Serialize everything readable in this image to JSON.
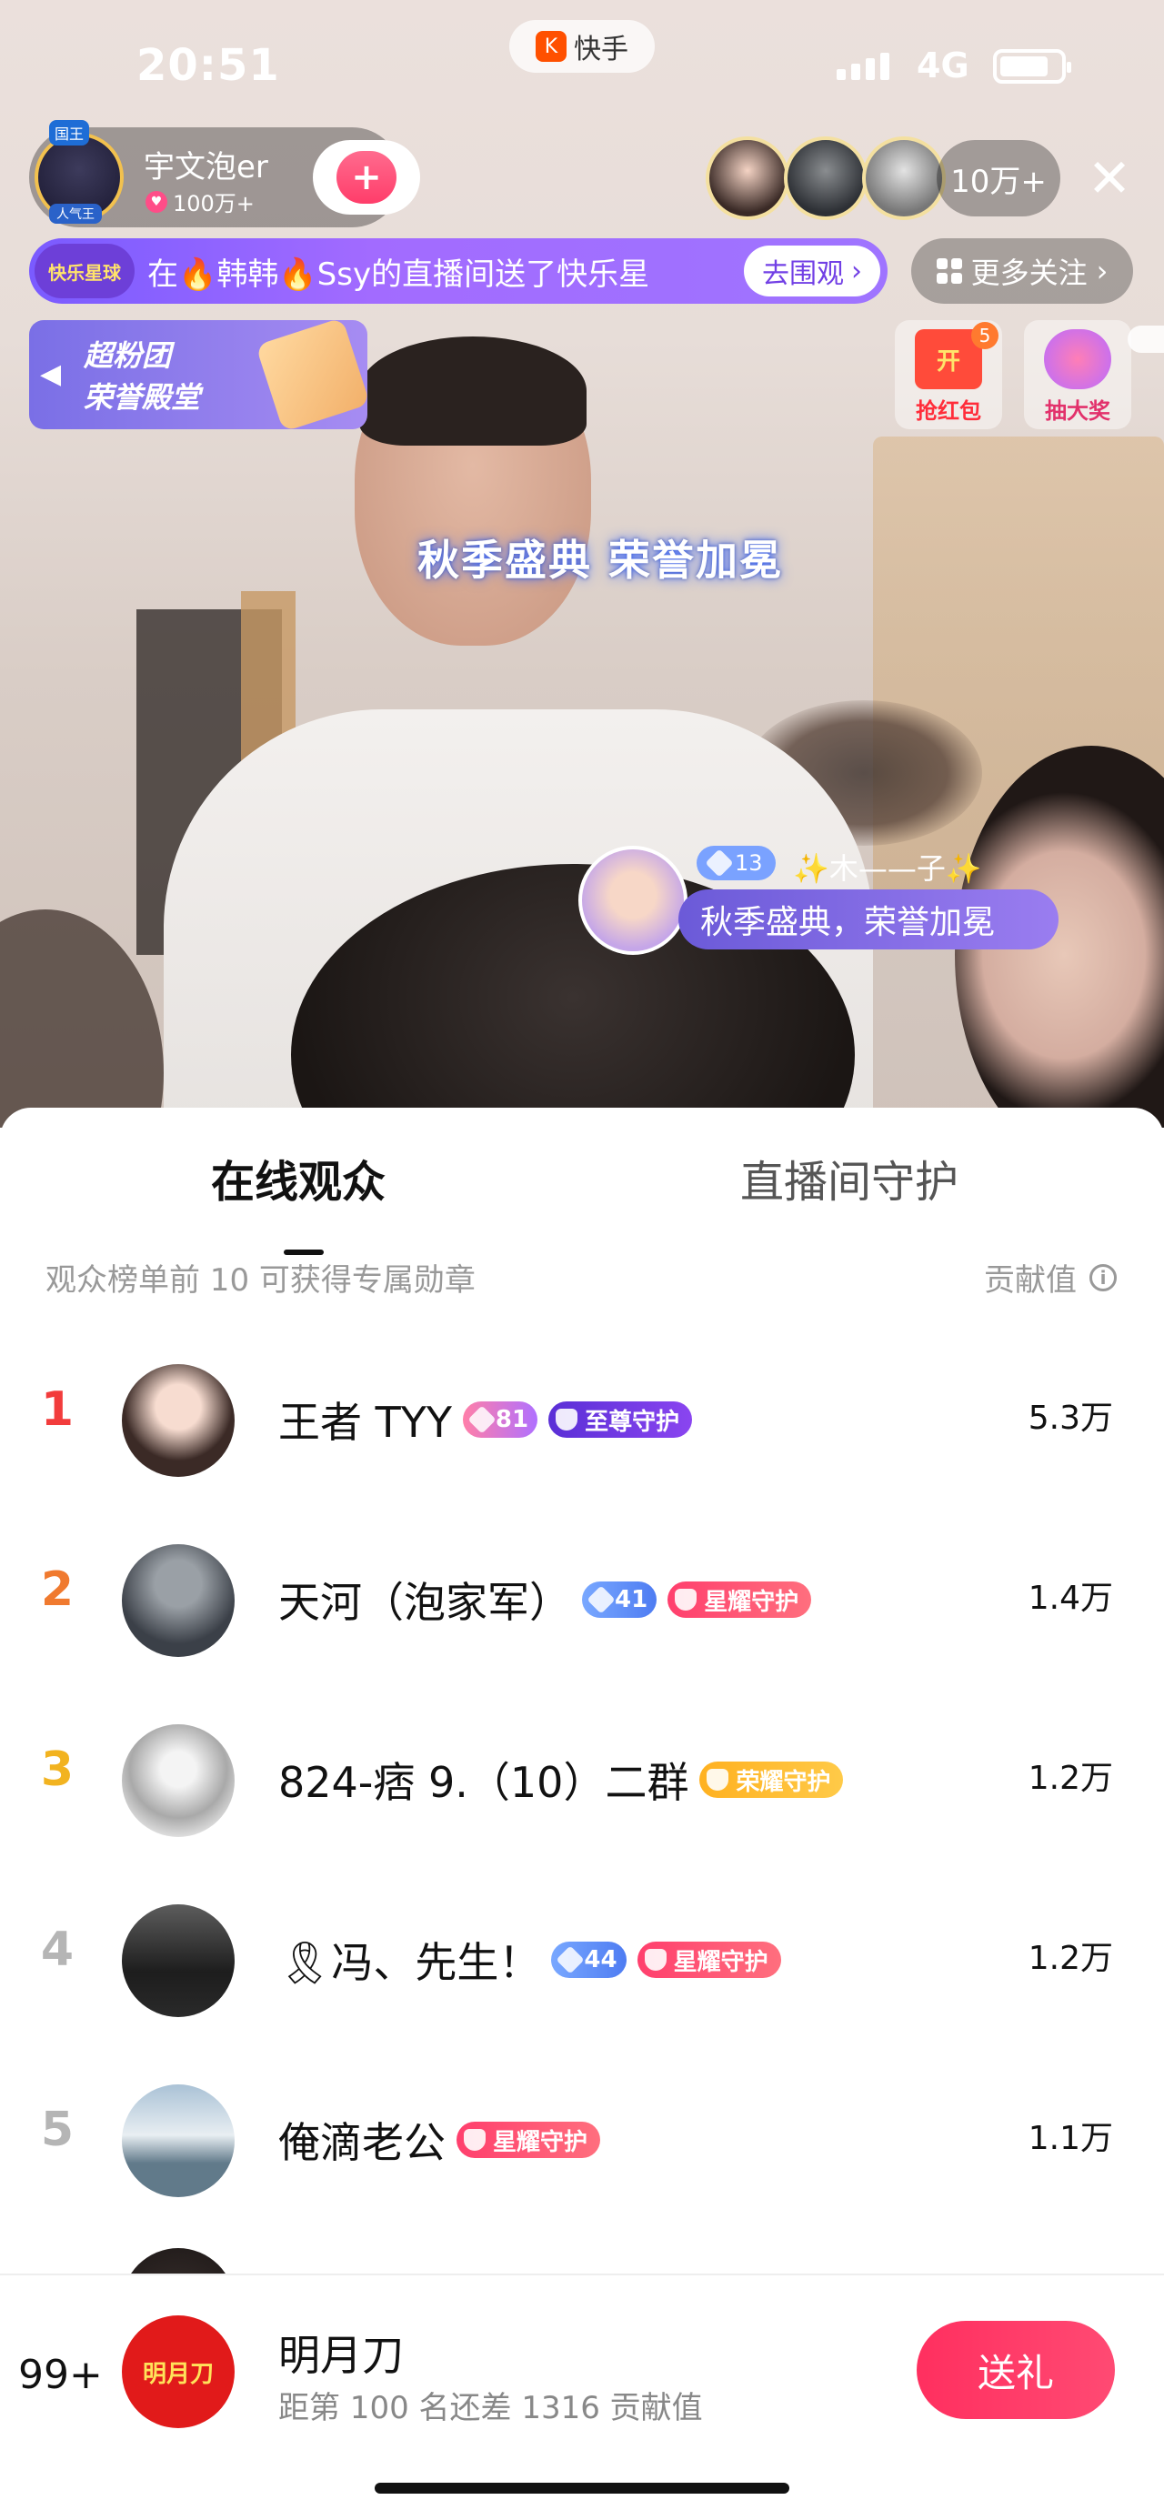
{
  "status": {
    "time": "20:51",
    "network": "4G"
  },
  "app": {
    "name": "快手",
    "logo_glyph": "K"
  },
  "host": {
    "name": "宇文泡er",
    "fans": "100万+",
    "crown": "国王",
    "tag": "人气王",
    "follow_icon": "+"
  },
  "viewers": {
    "count": "10万+"
  },
  "banner": {
    "badge": "快乐星球",
    "text": "在🔥韩韩🔥Ssy的直播间送了快乐星",
    "go_label": "去围观",
    "go_arrow": "›"
  },
  "more_follow": {
    "label": "更多关注",
    "arrow": "›"
  },
  "fan_card": {
    "line1": "超粉团",
    "line2": "荣誉殿堂",
    "arrow": "◀"
  },
  "red_packet": {
    "label": "抢红包",
    "box_text": "开",
    "count": "5"
  },
  "lottery": {
    "label": "抽大奖"
  },
  "event_title": "秋季盛典 荣誉加冕",
  "comment": {
    "level": "13",
    "nick": "✨木——子✨",
    "message": "秋季盛典，荣誉加冕"
  },
  "tabs": [
    {
      "label": "在线观众"
    },
    {
      "label": "直播间守护"
    }
  ],
  "list_hint": "观众榜单前 10 可获得专属勋章",
  "contrib_header": "贡献值",
  "info_glyph": "i",
  "ranking": [
    {
      "rank": "1",
      "name": "王者 TYY",
      "level": "81",
      "guard": "至尊守护",
      "value": "5.3万"
    },
    {
      "rank": "2",
      "name": "天河（泡家军）",
      "level": "41",
      "guard": "星耀守护",
      "value": "1.4万"
    },
    {
      "rank": "3",
      "name": "824-痞 9.（10）二群",
      "guard": "荣耀守护",
      "value": "1.2万"
    },
    {
      "rank": "4",
      "name": "🎗冯、先生！",
      "level": "44",
      "guard": "星耀守护",
      "value": "1.2万"
    },
    {
      "rank": "5",
      "name": "俺滴老公",
      "guard": "星耀守护",
      "value": "1.1万"
    }
  ],
  "me": {
    "rank": "99+",
    "avatar_text": "明月刀",
    "name": "明月刀",
    "gap_text": "距第 100 名还差 1316 贡献值"
  },
  "gift_button": "送礼",
  "colors": {
    "rank1": "#f23c3c",
    "rank2": "#f07a2f",
    "rank3": "#f2b320",
    "gift_button": "#ff2f5f",
    "banner": "#7a5bff"
  }
}
